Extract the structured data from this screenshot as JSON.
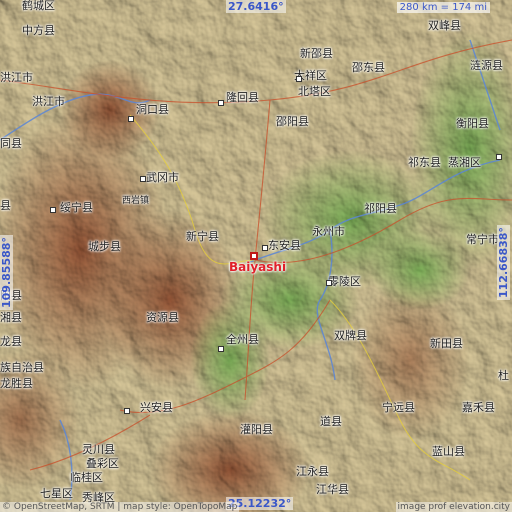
{
  "map": {
    "coord_top": "27.6416°",
    "coord_bottom": "25.12232°",
    "coord_left": "109.85588°",
    "coord_right": "112.66838°",
    "scale": "280 km = 174 mi",
    "attribution_left": "© OpenStreetMap, SRTM | map style: OpenTopoMap",
    "attribution_right": "image prof elevation.city",
    "highlight_city": "Baiyashi",
    "places": [
      {
        "name": "鹤城区"
      },
      {
        "name": "中方县"
      },
      {
        "name": "洪江市"
      },
      {
        "name": "洪江市"
      },
      {
        "name": "洞口县"
      },
      {
        "name": "隆回县"
      },
      {
        "name": "邵阳县"
      },
      {
        "name": "新邵县"
      },
      {
        "name": "邵东县"
      },
      {
        "name": "大祥区"
      },
      {
        "name": "北塔区"
      },
      {
        "name": "双峰县"
      },
      {
        "name": "衡阳县"
      },
      {
        "name": "祁东县"
      },
      {
        "name": "蒸湘区"
      },
      {
        "name": "武冈市"
      },
      {
        "name": "绥宁县"
      },
      {
        "name": "西岩镇"
      },
      {
        "name": "城步县"
      },
      {
        "name": "新宁县"
      },
      {
        "name": "东安县"
      },
      {
        "name": "永州市"
      },
      {
        "name": "祁阳县"
      },
      {
        "name": "常宁市"
      },
      {
        "name": "零陵区"
      },
      {
        "name": "资源县"
      },
      {
        "name": "双牌县"
      },
      {
        "name": "新田县"
      },
      {
        "name": "全州县"
      },
      {
        "name": "族自治县"
      },
      {
        "name": "龙胜县"
      },
      {
        "name": "兴安县"
      },
      {
        "name": "灌阳县"
      },
      {
        "name": "道县"
      },
      {
        "name": "宁远县"
      },
      {
        "name": "嘉禾县"
      },
      {
        "name": "灵川县"
      },
      {
        "name": "叠彩区"
      },
      {
        "name": "临桂区"
      },
      {
        "name": "七星区"
      },
      {
        "name": "江永县"
      },
      {
        "name": "江华县"
      },
      {
        "name": "蓝山县"
      },
      {
        "name": "同县"
      },
      {
        "name": "阳县"
      },
      {
        "name": "湘县"
      },
      {
        "name": "县"
      },
      {
        "name": "杜"
      },
      {
        "name": "龙县"
      },
      {
        "name": "秀峰区"
      },
      {
        "name": "涟源县"
      }
    ]
  }
}
